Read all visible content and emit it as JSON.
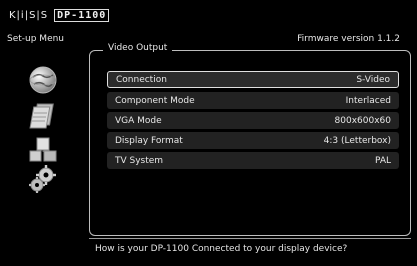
{
  "header": {
    "brand": "K|i|S|S",
    "model": "DP-1100",
    "menu_title": "Set-up Menu",
    "firmware": "Firmware version 1.1.2"
  },
  "sidebar": {
    "icons": [
      "globe-icon",
      "document-icon",
      "components-icon",
      "gears-icon"
    ]
  },
  "panel": {
    "title": "Video Output",
    "rows": [
      {
        "label": "Connection",
        "value": "S-Video",
        "selected": true
      },
      {
        "label": "Component Mode",
        "value": "Interlaced",
        "selected": false
      },
      {
        "label": "VGA Mode",
        "value": "800x600x60",
        "selected": false
      },
      {
        "label": "Display Format",
        "value": "4:3 (Letterbox)",
        "selected": false
      },
      {
        "label": "TV System",
        "value": "PAL",
        "selected": false
      }
    ]
  },
  "help": {
    "text": "How is your DP-1100 Connected to your display device?"
  }
}
